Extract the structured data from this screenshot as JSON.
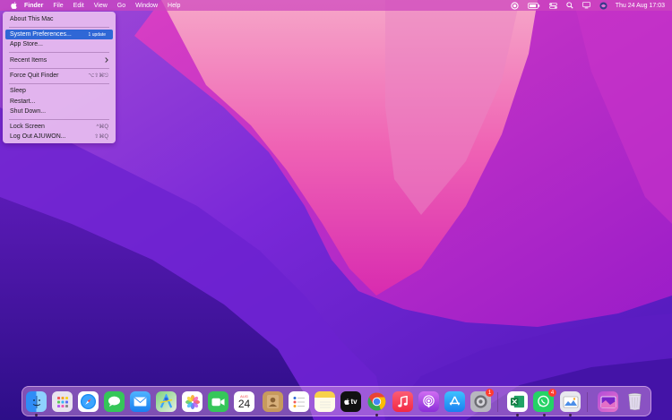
{
  "menubar": {
    "app_name": "Finder",
    "menus": [
      "File",
      "Edit",
      "View",
      "Go",
      "Window",
      "Help"
    ],
    "clock": "Thu 24 Aug  17:03"
  },
  "apple_menu": {
    "items": {
      "about": "About This Mac",
      "sysprefs": "System Preferences...",
      "sysprefs_badge": "1 update",
      "appstore": "App Store...",
      "recent": "Recent Items",
      "forcequit": "Force Quit Finder",
      "forcequit_shortcut": "⌥⇧⌘⎋",
      "sleep": "Sleep",
      "restart": "Restart...",
      "shutdown": "Shut Down...",
      "lock": "Lock Screen",
      "lock_shortcut": "^⌘Q",
      "logout": "Log Out AJUWON...",
      "logout_shortcut": "⇧⌘Q"
    }
  },
  "dock": {
    "calendar_month": "AUG",
    "calendar_day": "24",
    "tv_label": "tv",
    "settings_badge": "1",
    "whatsapp_badge": "4"
  },
  "colors": {
    "highlight": "#2f67d6",
    "menubar": "#cd46be",
    "badge": "#ff3b30"
  }
}
